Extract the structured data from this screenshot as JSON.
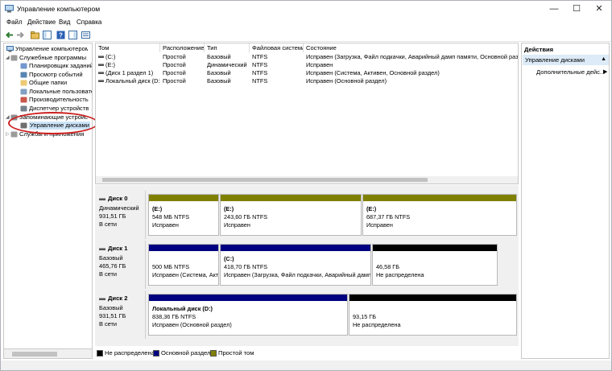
{
  "window": {
    "title": "Управление компьютером",
    "controls": {
      "minimize": "—",
      "maximize": "☐",
      "close": "✕"
    }
  },
  "menu": [
    "Файл",
    "Действие",
    "Вид",
    "Справка"
  ],
  "tree": {
    "root": "Управление компьютером (лс",
    "items": [
      {
        "label": "Служебные программы",
        "level": 1,
        "icon": "tools-icon"
      },
      {
        "label": "Планировщик заданий",
        "level": 2,
        "icon": "clock-icon"
      },
      {
        "label": "Просмотр событий",
        "level": 2,
        "icon": "event-viewer-icon"
      },
      {
        "label": "Общие папки",
        "level": 2,
        "icon": "shared-folder-icon"
      },
      {
        "label": "Локальные пользовате",
        "level": 2,
        "icon": "users-icon"
      },
      {
        "label": "Производительность",
        "level": 2,
        "icon": "performance-icon"
      },
      {
        "label": "Диспетчер устройств",
        "level": 2,
        "icon": "device-manager-icon"
      },
      {
        "label": "Запоминающие устройс",
        "level": 1,
        "icon": "storage-icon"
      },
      {
        "label": "Управление дисками",
        "level": 2,
        "icon": "disk-icon"
      },
      {
        "label": "Службы и приложения",
        "level": 1,
        "icon": "services-icon"
      }
    ]
  },
  "volumes": {
    "headers": [
      "Том",
      "Расположение",
      "Тип",
      "Файловая система",
      "Состояние"
    ],
    "rows": [
      [
        "(C:)",
        "Простой",
        "Базовый",
        "NTFS",
        "Исправен (Загрузка, Файл подкачки, Аварийный дамп памяти, Основной разде"
      ],
      [
        "(E:)",
        "Простой",
        "Динамический",
        "NTFS",
        "Исправен"
      ],
      [
        "(Диск 1 раздел 1)",
        "Простой",
        "Базовый",
        "NTFS",
        "Исправен (Система, Активен, Основной раздел)"
      ],
      [
        "Локальный диск (D:)",
        "Простой",
        "Базовый",
        "NTFS",
        "Исправен (Основной раздел)"
      ]
    ]
  },
  "disks": [
    {
      "name": "Диск 0",
      "type": "Динамический",
      "size": "931,51 ГБ",
      "status": "В сети",
      "partitions": [
        {
          "name": "(E:)",
          "size": "548 МБ NTFS",
          "status": "Исправен",
          "color": "#808000"
        },
        {
          "name": "(E:)",
          "size": "243,60 ГБ NTFS",
          "status": "Исправен",
          "color": "#808000"
        },
        {
          "name": "(E:)",
          "size": "687,37 ГБ NTFS",
          "status": "Исправен",
          "color": "#808000"
        }
      ]
    },
    {
      "name": "Диск 1",
      "type": "Базовый",
      "size": "465,76 ГБ",
      "status": "В сети",
      "partitions": [
        {
          "name": "",
          "size": "500 МБ NTFS",
          "status": "Исправен (Система, Акти",
          "color": "#000080"
        },
        {
          "name": "(C:)",
          "size": "418,70 ГБ NTFS",
          "status": "Исправен (Загрузка, Файл подкачки, Аварийный дамп",
          "color": "#000080"
        },
        {
          "name": "",
          "size": "46,58 ГБ",
          "status": "Не распределена",
          "color": "#000000"
        }
      ]
    },
    {
      "name": "Диск 2",
      "type": "Базовый",
      "size": "931,51 ГБ",
      "status": "В сети",
      "partitions": [
        {
          "name": "Локальный диск  (D:)",
          "size": "838,36 ГБ NTFS",
          "status": "Исправен (Основной раздел)",
          "color": "#000080"
        },
        {
          "name": "",
          "size": "93,15 ГБ",
          "status": "Не распределена",
          "color": "#000000"
        }
      ]
    }
  ],
  "legend": [
    {
      "label": "Не распределена",
      "color": "#000000"
    },
    {
      "label": "Основной раздел",
      "color": "#000080"
    },
    {
      "label": "Простой том",
      "color": "#808000"
    }
  ],
  "actions": {
    "title": "Действия",
    "section": "Управление дисками",
    "more": "Дополнительные дейс..."
  }
}
